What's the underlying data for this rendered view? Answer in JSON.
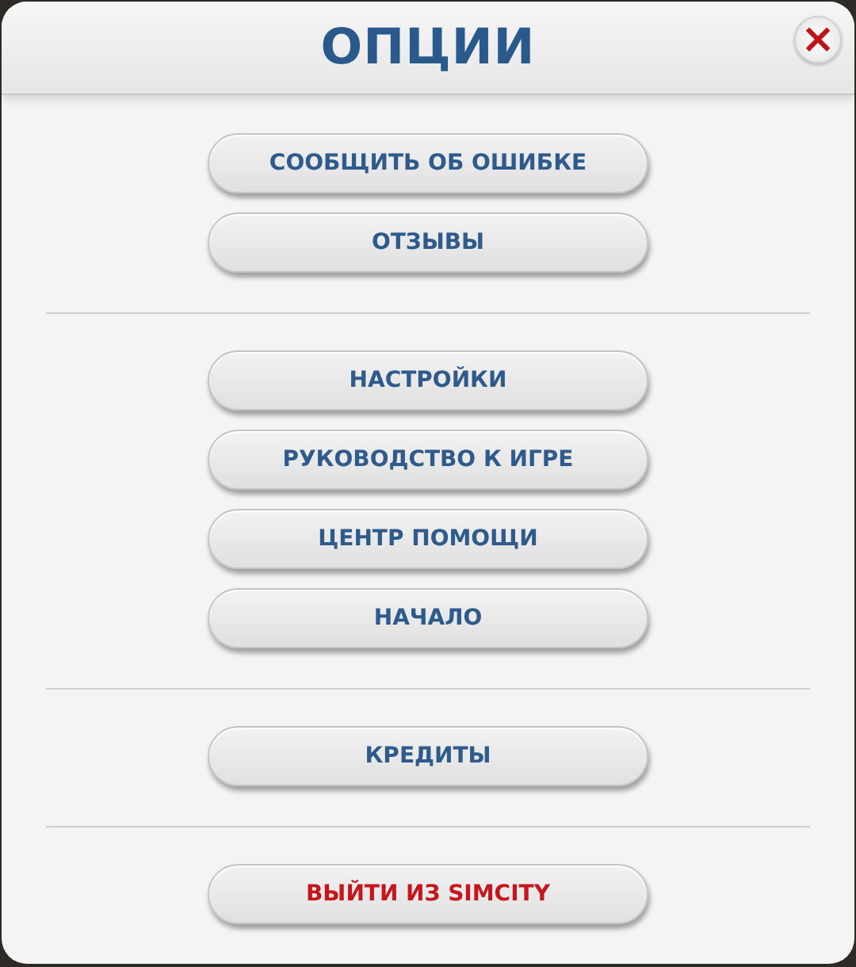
{
  "window": {
    "title": "ОПЦИИ",
    "close_label": "×"
  },
  "groups": [
    {
      "buttons": [
        {
          "label": "СООБЩИТЬ ОБ ОШИБКЕ",
          "kind": "normal"
        },
        {
          "label": "ОТЗЫВЫ",
          "kind": "normal"
        }
      ]
    },
    {
      "buttons": [
        {
          "label": "НАСТРОЙКИ",
          "kind": "normal"
        },
        {
          "label": "РУКОВОДСТВО К ИГРЕ",
          "kind": "normal"
        },
        {
          "label": "ЦЕНТР ПОМОЩИ",
          "kind": "normal"
        },
        {
          "label": "НАЧАЛО",
          "kind": "normal"
        }
      ]
    },
    {
      "buttons": [
        {
          "label": "КРЕДИТЫ",
          "kind": "normal"
        }
      ]
    },
    {
      "buttons": [
        {
          "label": "ВЫЙТИ ИЗ SIMCITY",
          "kind": "danger"
        }
      ]
    }
  ]
}
